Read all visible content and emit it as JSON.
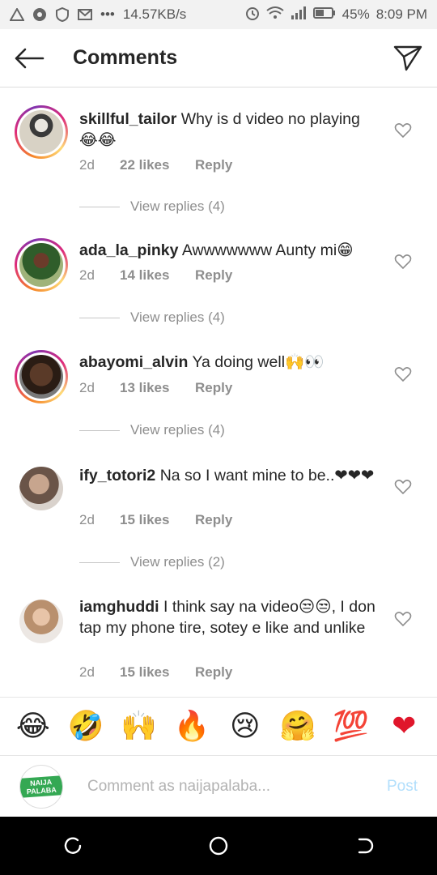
{
  "status_bar": {
    "speed": "14.57KB/s",
    "battery": "45%",
    "time": "8:09 PM"
  },
  "header": {
    "title": "Comments"
  },
  "comments": [
    {
      "username": "skillful_tailor",
      "text": "Why is d video no playing 😂😂",
      "time": "2d",
      "likes": "22 likes",
      "reply": "Reply",
      "view_replies": "View replies (4)"
    },
    {
      "username": "ada_la_pinky",
      "text": "Awwwwwww Aunty mi😁",
      "time": "2d",
      "likes": "14 likes",
      "reply": "Reply",
      "view_replies": "View replies (4)"
    },
    {
      "username": "abayomi_alvin",
      "text": "Ya doing well🙌👀",
      "time": "2d",
      "likes": "13 likes",
      "reply": "Reply",
      "view_replies": "View replies (4)"
    },
    {
      "username": "ify_totori2",
      "text": "Na so I want mine to be..❤❤❤",
      "time": "2d",
      "likes": "15 likes",
      "reply": "Reply",
      "view_replies": "View replies (2)"
    },
    {
      "username": "iamghuddi",
      "text": "I think say na video😒😒, I don tap my phone tire, sotey e like and unlike",
      "time": "2d",
      "likes": "15 likes",
      "reply": "Reply"
    }
  ],
  "emoji_bar": [
    "😂",
    "🤣",
    "🙌",
    "🔥",
    "😢",
    "🤗",
    "💯",
    "❤"
  ],
  "composer": {
    "avatar_logo_text": "NAIJA PALABA",
    "placeholder": "Comment as naijapalaba...",
    "post_label": "Post"
  },
  "colors": {
    "accent_disabled": "#b2dffc",
    "muted_text": "#8e8e8e",
    "heart_red": "#e0162b"
  }
}
